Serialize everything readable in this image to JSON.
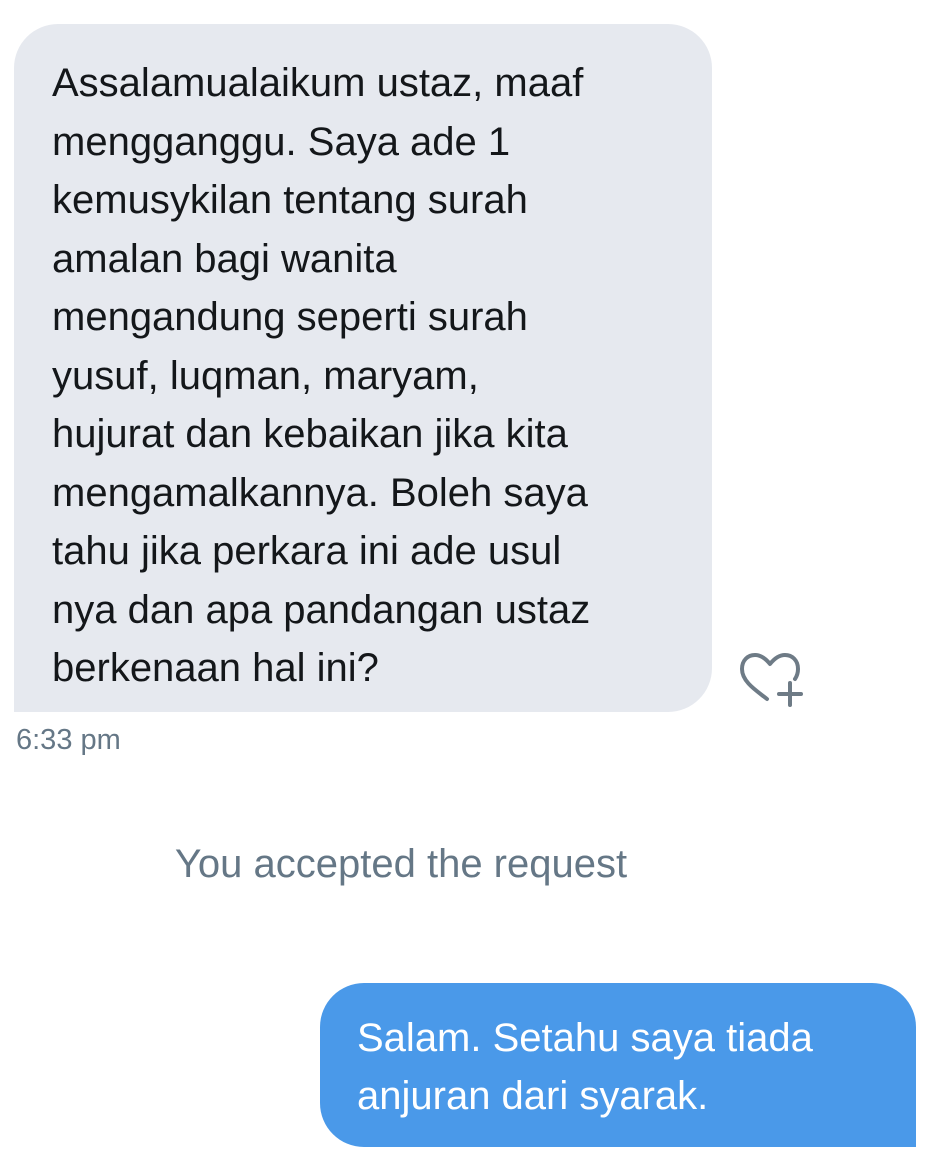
{
  "conversation": {
    "incoming_message": {
      "text": "Assalamualaikum ustaz, maaf\nmengganggu. Saya ade 1\nkemusykilan tentang surah\namalan bagi wanita\nmengandung seperti surah\nyusuf, luqman, maryam,\nhujurat dan kebaikan jika kita\nmengamalkannya. Boleh saya\ntahu jika perkara ini ade usul\nnya dan apa pandangan ustaz\nberkenaan hal ini?",
      "time": "6:33 pm",
      "reaction_icon": "heart-plus-icon"
    },
    "system_note": "You accepted the request",
    "outgoing_message": {
      "text": "Salam. Setahu saya tiada\nanjuran dari syarak."
    }
  },
  "colors": {
    "incoming_bubble": "#e6e9ef",
    "outgoing_bubble": "#4a99e9",
    "secondary_text": "#657786",
    "primary_text": "#14171a"
  }
}
